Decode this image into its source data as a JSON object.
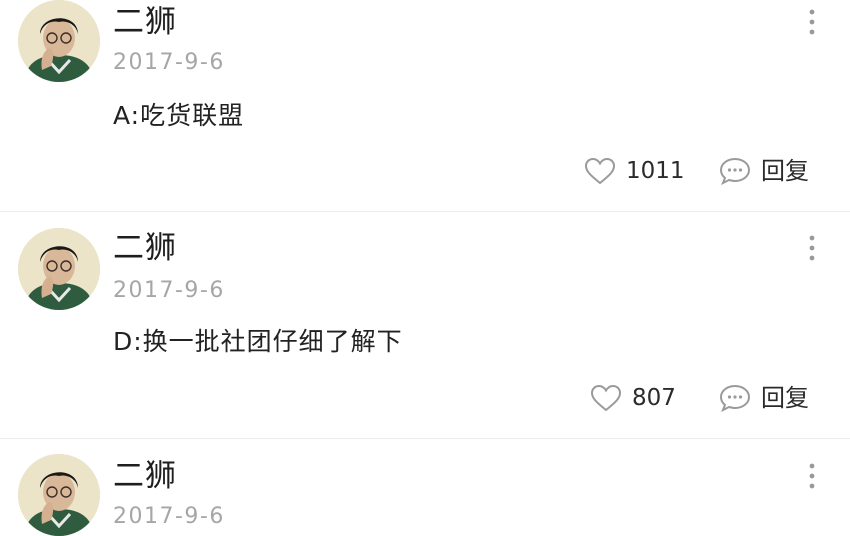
{
  "comments": [
    {
      "username": "二狮",
      "date": "2017-9-6",
      "content": "A:吃货联盟",
      "likes": "1011",
      "reply_label": "回复"
    },
    {
      "username": "二狮",
      "date": "2017-9-6",
      "content": "D:换一批社团仔细了解下",
      "likes": "807",
      "reply_label": "回复"
    },
    {
      "username": "二狮",
      "date": "2017-9-6"
    }
  ],
  "icons": {
    "like": "heart-outline-icon",
    "reply": "speech-bubble-icon",
    "more": "vertical-ellipsis-icon"
  },
  "colors": {
    "date": "#a6a6a6",
    "divider": "#ececec",
    "icon": "#9a9a9a"
  }
}
